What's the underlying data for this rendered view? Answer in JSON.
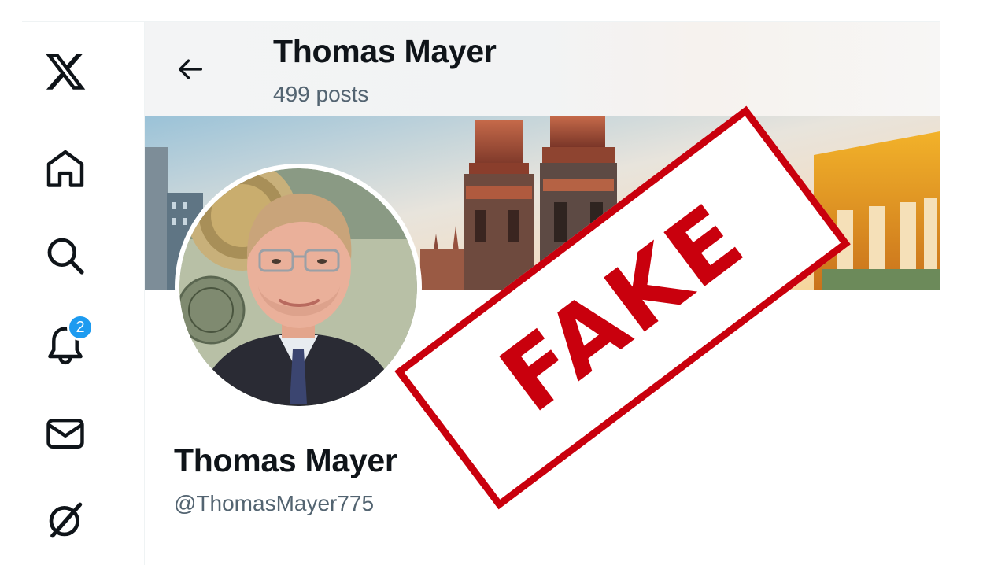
{
  "header": {
    "title": "Thomas Mayer",
    "posts_count": "499 posts"
  },
  "sidebar": {
    "items": [
      {
        "icon": "x-logo-icon"
      },
      {
        "icon": "home-icon"
      },
      {
        "icon": "search-icon"
      },
      {
        "icon": "bell-icon",
        "badge": "2"
      },
      {
        "icon": "mail-icon"
      },
      {
        "icon": "grok-icon"
      }
    ]
  },
  "profile": {
    "display_name": "Thomas Mayer",
    "handle": "@ThomasMayer775"
  },
  "stamp": {
    "text": "FAKE",
    "color": "#c9000d"
  },
  "colors": {
    "accent": "#1d9bf0",
    "text_primary": "#0f1419",
    "text_secondary": "#536471"
  }
}
